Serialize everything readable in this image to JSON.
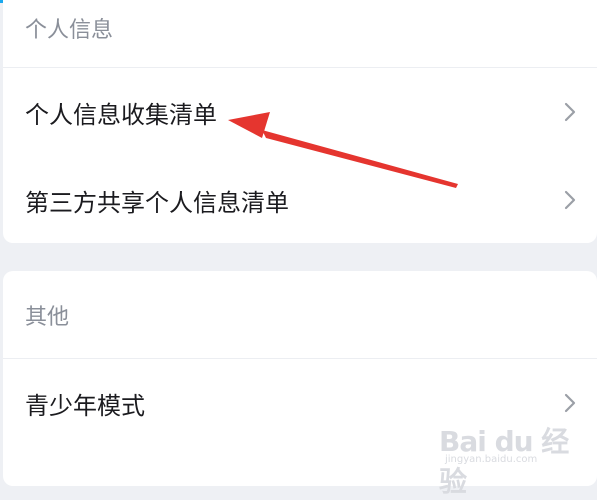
{
  "sections": [
    {
      "header": "个人信息",
      "rows": [
        {
          "label": "个人信息收集清单"
        },
        {
          "label": "第三方共享个人信息清单"
        }
      ]
    },
    {
      "header": "其他",
      "rows": [
        {
          "label": "青少年模式"
        }
      ]
    }
  ],
  "icons": {
    "row_chevron": "chevron-right-icon",
    "annotation": "red-arrow-pointer"
  },
  "colors": {
    "accent_top": "#1aa8ee",
    "annotation_arrow": "#e5352f",
    "page_background": "#eef0f4"
  },
  "watermark": {
    "logo": "Bai du 经验",
    "sub": "jingyan.baidu.com"
  }
}
